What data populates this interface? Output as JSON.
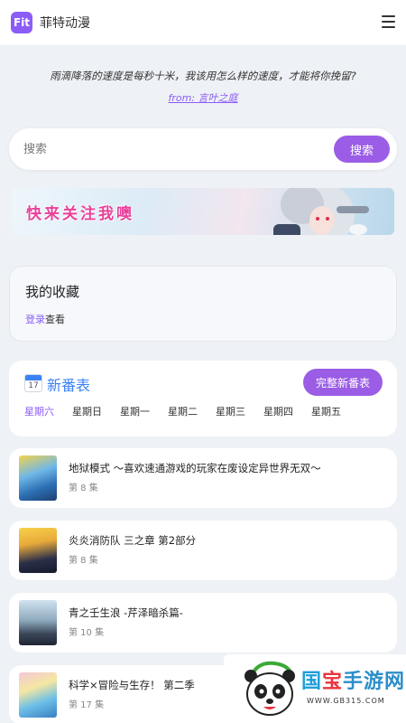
{
  "header": {
    "logo_text": "Fit",
    "site_name": "菲特动漫"
  },
  "quote": {
    "text": "雨滴降落的速度是每秒十米，我该用怎么样的速度，才能将你挽留?",
    "source": "from: 言叶之庭"
  },
  "search": {
    "placeholder": "搜索",
    "button_label": "搜索"
  },
  "banner": {
    "text": "快来关注我噢"
  },
  "favorites": {
    "title": "我的收藏",
    "login_link": "登录",
    "hint_suffix": "查看"
  },
  "schedule": {
    "calendar_number": "17",
    "title": "新番表",
    "full_button": "完整新番表",
    "days": [
      "星期六",
      "星期日",
      "星期一",
      "星期二",
      "星期三",
      "星期四",
      "星期五"
    ],
    "active_day": "星期六"
  },
  "episodes": [
    {
      "title": "地狱模式 ～喜欢速通游戏的玩家在废设定异世界无双～",
      "episode": "第 8 集"
    },
    {
      "title": "炎炎消防队 三之章 第2部分",
      "episode": "第 8 集"
    },
    {
      "title": "青之壬生浪 -芹泽暗杀篇-",
      "episode": "第 10 集"
    },
    {
      "title": "科学×冒险与生存！ 第二季",
      "episode": "第 17 集"
    }
  ],
  "watermark": {
    "c1": "国",
    "c2": "宝",
    "c3": "手游网",
    "url": "WWW.GB315.COM"
  },
  "colors": {
    "accent": "#9b5de5",
    "link": "#8b5cf6",
    "schedule_title": "#3b82f6",
    "background": "#eef1f5"
  }
}
